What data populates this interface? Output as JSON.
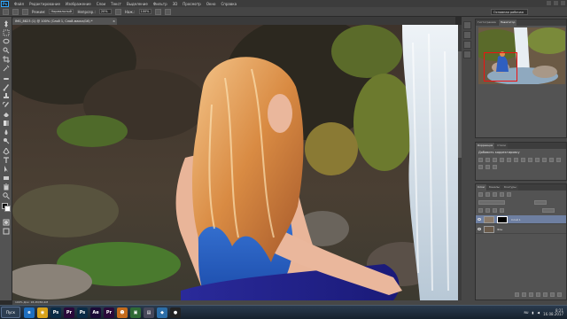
{
  "menu": {
    "logo": "Ps",
    "items": [
      "Файл",
      "Редактирование",
      "Изображение",
      "Слои",
      "Текст",
      "Выделение",
      "Фильтр",
      "3D",
      "Просмотр",
      "Окно",
      "Справка"
    ]
  },
  "options": {
    "mode_label": "Режим:",
    "mode_value": "Нормальный",
    "opacity_label": "Непрозр.:",
    "opacity_value": "20%",
    "flow_label": "Наж.:",
    "flow_value": "100%",
    "workspace": "Основная рабочая среда"
  },
  "document": {
    "tab_title": "IMG_8823 (1) @ 100% (Слой 1, Слой-маска/16) *",
    "close": "×"
  },
  "statusbar": {
    "zoom_info": "100%   Док: 18,2M/80,4M"
  },
  "panels": {
    "top_tabs": [
      "Гистограмма",
      "Навигатор"
    ],
    "adjust_tabs": [
      "Коррекция",
      "Стили"
    ],
    "adjust_title": "Добавить корректировку",
    "layers_tabs": [
      "Слои",
      "Каналы",
      "Контуры"
    ],
    "layers": [
      {
        "name": "Слой 1",
        "selected": true
      },
      {
        "name": "Фон",
        "selected": false
      }
    ]
  },
  "taskbar": {
    "start": "Пуск",
    "apps": [
      {
        "label": "e",
        "color": "#1e6fc0"
      },
      {
        "label": "◉",
        "color": "#d8a21a"
      },
      {
        "label": "Ps",
        "color": "#0b2b45"
      },
      {
        "label": "Pr",
        "color": "#2a0a3a"
      },
      {
        "label": "Ps",
        "color": "#0b2b45"
      },
      {
        "label": "Ae",
        "color": "#1a0a36"
      },
      {
        "label": "Pr",
        "color": "#2a0a3a"
      },
      {
        "label": "☻",
        "color": "#c46b1c"
      },
      {
        "label": "▣",
        "color": "#2f6a35"
      },
      {
        "label": "▤",
        "color": "#46485a"
      },
      {
        "label": "◆",
        "color": "#2c6ea8"
      },
      {
        "label": "●",
        "color": "#222222"
      }
    ],
    "lang": "RU",
    "time": "8:21",
    "date": "16.08.2017"
  }
}
